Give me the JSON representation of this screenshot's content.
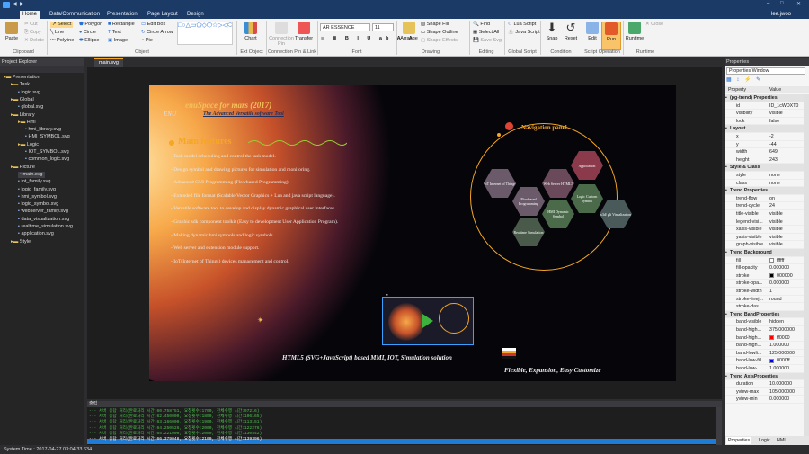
{
  "window": {
    "user": "lee.jwoo"
  },
  "tabs": [
    "Home",
    "Data/Communication",
    "Presentation",
    "Page Layout",
    "Design"
  ],
  "ribbon": {
    "clipboard": {
      "label": "Clipboard",
      "paste": "Paste",
      "cut": "Cut",
      "copy": "Copy",
      "delete": "Delete"
    },
    "object": {
      "label": "Object",
      "select": "Select",
      "line": "Line",
      "polyline": "Polyline",
      "polygon": "Polygon",
      "circle": "Circle",
      "ellipse": "Ellipse",
      "rectangle": "Rectangle",
      "text": "Text",
      "image": "Image",
      "edit_box": "Edit Box",
      "circle_arrow": "Circle Arrow",
      "pie": "Pie"
    },
    "ext_object": {
      "label": "Ext Object",
      "chart": "Chart"
    },
    "connection": {
      "label": "Connection Pin & Link",
      "pin": "Connection Pin",
      "transfer": "Transfer"
    },
    "font": {
      "label": "Font",
      "name": "AR ESSENCE",
      "size": "11"
    },
    "drawing": {
      "label": "Drawing",
      "arrange": "Arrange",
      "shape_fill": "Shape Fill",
      "shape_outline": "Shape Outline",
      "shape_effects": "Shape Effects"
    },
    "editing": {
      "label": "Editing",
      "find": "Find",
      "select_all": "Select All",
      "save_svg": "Save Svg"
    },
    "global_script": {
      "label": "Global Script",
      "lua": "Lua Script",
      "java": "Java Script"
    },
    "condition": {
      "label": "Condition",
      "snap": "Snap",
      "reset": "Reset"
    },
    "script_operation": {
      "label": "Script Operation",
      "edit": "Edit",
      "run": "Run"
    },
    "runtime": {
      "label": "Runtime",
      "runtime": "Runtime",
      "close": "Close"
    }
  },
  "explorer": {
    "title": "Project Explorer",
    "items": [
      {
        "label": "Presentation",
        "indent": 0
      },
      {
        "label": "Task",
        "indent": 1
      },
      {
        "label": "logic.svg",
        "indent": 2
      },
      {
        "label": "Global",
        "indent": 1
      },
      {
        "label": "global.svg",
        "indent": 2
      },
      {
        "label": "Library",
        "indent": 1
      },
      {
        "label": "Hmi",
        "indent": 2
      },
      {
        "label": "hmi_library.svg",
        "indent": 3
      },
      {
        "label": "HMI_SYMBOL.svg",
        "indent": 3
      },
      {
        "label": "Logic",
        "indent": 2
      },
      {
        "label": "IOT_SYMBOL.svg",
        "indent": 3
      },
      {
        "label": "common_logic.svg",
        "indent": 3
      },
      {
        "label": "Picture",
        "indent": 1
      },
      {
        "label": "main.svg",
        "indent": 2
      },
      {
        "label": "iot_family.svg",
        "indent": 2
      },
      {
        "label": "logic_family.svg",
        "indent": 2
      },
      {
        "label": "hmi_symbol.svg",
        "indent": 2
      },
      {
        "label": "logic_symbol.svg",
        "indent": 2
      },
      {
        "label": "webserver_family.svg",
        "indent": 2
      },
      {
        "label": "data_visualization.svg",
        "indent": 2
      },
      {
        "label": "realtime_simulation.svg",
        "indent": 2
      },
      {
        "label": "application.svg",
        "indent": 2
      },
      {
        "label": "Style",
        "indent": 1
      }
    ]
  },
  "document": {
    "tab": "main.svg",
    "title": "enuSpace for mars (2017)",
    "subtitle": "The Advanced Versatile software Tool",
    "logo": "ENU",
    "features_heading": "Main features",
    "features": [
      "- Task model scheduling and control the task model.",
      "- Design symbol and drawing pictures for simulation and monitoring.",
      "- Advanced GUI Programming (Flowbased Programming).",
      "- Extended file format (Scalable Vector Graphics + Lua and java script language).",
      "- Versatile software tool to develop and display dynamic graphical user interfaces.",
      "- Graphic sdk component toolkit (Easy to development User Application Program).",
      "- Making dynamic hmi symbols and logic symbols.",
      "- Web server and extension module support.",
      "- IoT(Internet of Things) devices management and control."
    ],
    "nav_title": "Navigation panel",
    "nav_items": [
      "IoT Internet of Things",
      "Flowbased Programming",
      "Web Server HTML5",
      "Application",
      "Logic Custom Symbol",
      "HMI Dynamic Symbol",
      "Realtime Simulation",
      "x3d/ glt Visualization"
    ],
    "footer": "HTML5 (SVG+JavaScript) based MMI, IOT, Simulation  solution",
    "tagline": "Flexible, Expansion, Easy Customize"
  },
  "output": {
    "title": "출력",
    "lines": [
      "--- 서버 응답 처리(완료처리 시간:60.758751, 요청횟수:1700, 전체수행 시간:97216)",
      "--- 서버 응답 처리(완료처리 시간:62.450000, 요청횟수:1800, 전체수행 시간:106165)",
      "--- 서버 응답 처리(완료처리 시간:63.166000, 요청횟수:1900, 전체수행 시간:113151)",
      "--- 서버 응답 처리(완료처리 시간:64.250526, 요청횟수:2000, 전체수행 시간:122276)",
      "--- 서버 응답 처리(완료처리 시간:65.221000, 요청횟수:2000, 전체수행 시간:130442)",
      "--- 서버 응답 처리(완료처리 시간:66.379048, 요청횟수:2100, 전체수행 시간:139396)"
    ]
  },
  "properties": {
    "title": "Properties",
    "window": "Properties Window",
    "col_property": "Property",
    "col_value": "Value",
    "rows": [
      {
        "k": "(pg-trend) Properties",
        "sec": true
      },
      {
        "k": "id",
        "v": "ID_1cWDXT0"
      },
      {
        "k": "visibility",
        "v": "visible"
      },
      {
        "k": "lock",
        "v": "false"
      },
      {
        "k": "Layout",
        "sec": true
      },
      {
        "k": "x",
        "v": "-2"
      },
      {
        "k": "y",
        "v": "-44"
      },
      {
        "k": "width",
        "v": "649"
      },
      {
        "k": "height",
        "v": "243"
      },
      {
        "k": "Style & Class",
        "sec": true
      },
      {
        "k": "style",
        "v": "none"
      },
      {
        "k": "class",
        "v": "none"
      },
      {
        "k": "Trend Properties",
        "sec": true
      },
      {
        "k": "trend-flow",
        "v": "on"
      },
      {
        "k": "trend-cycle",
        "v": "24"
      },
      {
        "k": "title-visible",
        "v": "visible"
      },
      {
        "k": "legend-visi...",
        "v": "visible"
      },
      {
        "k": "xaxis-visible",
        "v": "visible"
      },
      {
        "k": "yaxis-visible",
        "v": "visible"
      },
      {
        "k": "graph-visible",
        "v": "visible"
      },
      {
        "k": "Trend Background",
        "sec": true
      },
      {
        "k": "fill",
        "v": "ffffff",
        "sw": "#ffffff"
      },
      {
        "k": "fill-opacity",
        "v": "0.000000"
      },
      {
        "k": "stroke",
        "v": "000000",
        "sw": "#000000"
      },
      {
        "k": "stroke-opa...",
        "v": "0.000000"
      },
      {
        "k": "stroke-width",
        "v": "1"
      },
      {
        "k": "stroke-linej...",
        "v": "round"
      },
      {
        "k": "stroke-das...",
        "v": ""
      },
      {
        "k": "Trend BandProperties",
        "sec": true
      },
      {
        "k": "band-visible",
        "v": "hidden"
      },
      {
        "k": "band-high...",
        "v": "375.000000"
      },
      {
        "k": "band-high...",
        "v": "ff0000",
        "sw": "#ff0000"
      },
      {
        "k": "band-high...",
        "v": "1.000000"
      },
      {
        "k": "band-lowli...",
        "v": "125.000000"
      },
      {
        "k": "band-low-fill",
        "v": "0000ff",
        "sw": "#0000ff"
      },
      {
        "k": "band-low-...",
        "v": "1.000000"
      },
      {
        "k": "Trend AxisProperties",
        "sec": true
      },
      {
        "k": "duration",
        "v": "10.000000"
      },
      {
        "k": "yview-max",
        "v": "105.000000"
      },
      {
        "k": "yview-min",
        "v": "0.000000"
      }
    ],
    "bottom_tabs": [
      "Properties",
      "Logic",
      "HMI"
    ]
  },
  "status": {
    "text": "System Time : 2017-04-27 03:04:33.634"
  }
}
